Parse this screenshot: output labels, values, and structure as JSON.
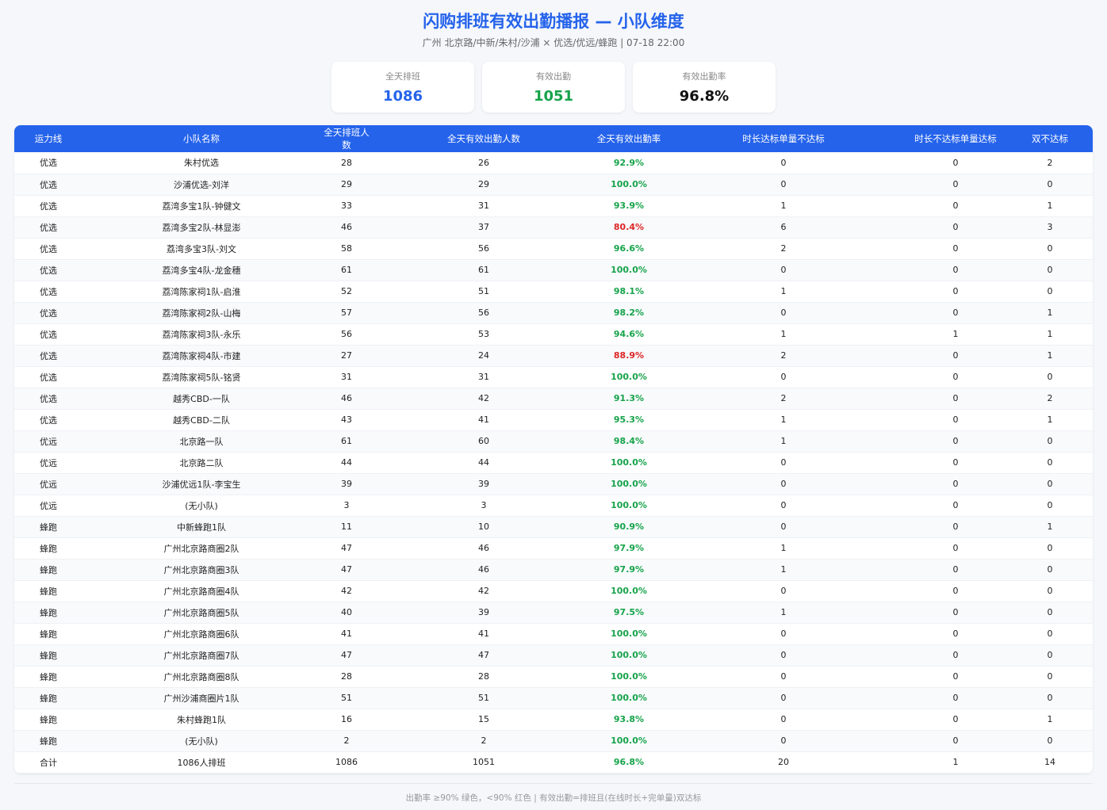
{
  "header": {
    "title": "闪购排班有效出勤播报 — 小队维度",
    "subtitle": "广州 北京路/中新/朱村/沙浦 × 优选/优远/蜂跑 | 07-18 22:00"
  },
  "cards": [
    {
      "label": "全天排班",
      "value": "1086"
    },
    {
      "label": "有效出勤",
      "value": "1051"
    },
    {
      "label": "有效出勤率",
      "value": "96.8%"
    }
  ],
  "table": {
    "columns": [
      "运力线",
      "小队名称",
      "全天排班人数",
      "全天有效出勤人数",
      "全天有效出勤率",
      "时长达标单量不达标",
      "时长不达标单量达标",
      "双不达标"
    ],
    "rows": [
      [
        "优选",
        "朱村优选",
        "28",
        "26",
        "92.9%",
        "0",
        "0",
        "2"
      ],
      [
        "优选",
        "沙浦优选-刘洋",
        "29",
        "29",
        "100.0%",
        "0",
        "0",
        "0"
      ],
      [
        "优选",
        "荔湾多宝1队-钟健文",
        "33",
        "31",
        "93.9%",
        "1",
        "0",
        "1"
      ],
      [
        "优选",
        "荔湾多宝2队-林显澎",
        "46",
        "37",
        "80.4%",
        "6",
        "0",
        "3"
      ],
      [
        "优选",
        "荔湾多宝3队-刘文",
        "58",
        "56",
        "96.6%",
        "2",
        "0",
        "0"
      ],
      [
        "优选",
        "荔湾多宝4队-龙金穗",
        "61",
        "61",
        "100.0%",
        "0",
        "0",
        "0"
      ],
      [
        "优选",
        "荔湾陈家祠1队-启淮",
        "52",
        "51",
        "98.1%",
        "1",
        "0",
        "0"
      ],
      [
        "优选",
        "荔湾陈家祠2队-山梅",
        "57",
        "56",
        "98.2%",
        "0",
        "0",
        "1"
      ],
      [
        "优选",
        "荔湾陈家祠3队-永乐",
        "56",
        "53",
        "94.6%",
        "1",
        "1",
        "1"
      ],
      [
        "优选",
        "荔湾陈家祠4队-市建",
        "27",
        "24",
        "88.9%",
        "2",
        "0",
        "1"
      ],
      [
        "优选",
        "荔湾陈家祠5队-铭贤",
        "31",
        "31",
        "100.0%",
        "0",
        "0",
        "0"
      ],
      [
        "优选",
        "越秀CBD-一队",
        "46",
        "42",
        "91.3%",
        "2",
        "0",
        "2"
      ],
      [
        "优选",
        "越秀CBD-二队",
        "43",
        "41",
        "95.3%",
        "1",
        "0",
        "1"
      ],
      [
        "优远",
        "北京路一队",
        "61",
        "60",
        "98.4%",
        "1",
        "0",
        "0"
      ],
      [
        "优远",
        "北京路二队",
        "44",
        "44",
        "100.0%",
        "0",
        "0",
        "0"
      ],
      [
        "优远",
        "沙浦优远1队-李宝生",
        "39",
        "39",
        "100.0%",
        "0",
        "0",
        "0"
      ],
      [
        "优远",
        "(无小队)",
        "3",
        "3",
        "100.0%",
        "0",
        "0",
        "0"
      ],
      [
        "蜂跑",
        "中新蜂跑1队",
        "11",
        "10",
        "90.9%",
        "0",
        "0",
        "1"
      ],
      [
        "蜂跑",
        "广州北京路商圈2队",
        "47",
        "46",
        "97.9%",
        "1",
        "0",
        "0"
      ],
      [
        "蜂跑",
        "广州北京路商圈3队",
        "47",
        "46",
        "97.9%",
        "1",
        "0",
        "0"
      ],
      [
        "蜂跑",
        "广州北京路商圈4队",
        "42",
        "42",
        "100.0%",
        "0",
        "0",
        "0"
      ],
      [
        "蜂跑",
        "广州北京路商圈5队",
        "40",
        "39",
        "97.5%",
        "1",
        "0",
        "0"
      ],
      [
        "蜂跑",
        "广州北京路商圈6队",
        "41",
        "41",
        "100.0%",
        "0",
        "0",
        "0"
      ],
      [
        "蜂跑",
        "广州北京路商圈7队",
        "47",
        "47",
        "100.0%",
        "0",
        "0",
        "0"
      ],
      [
        "蜂跑",
        "广州北京路商圈8队",
        "28",
        "28",
        "100.0%",
        "0",
        "0",
        "0"
      ],
      [
        "蜂跑",
        "广州沙浦商圈片1队",
        "51",
        "51",
        "100.0%",
        "0",
        "0",
        "0"
      ],
      [
        "蜂跑",
        "朱村蜂跑1队",
        "16",
        "15",
        "93.8%",
        "0",
        "0",
        "1"
      ],
      [
        "蜂跑",
        "(无小队)",
        "2",
        "2",
        "100.0%",
        "0",
        "0",
        "0"
      ]
    ],
    "total": [
      "合计",
      "1086人排班",
      "1086",
      "1051",
      "96.8%",
      "20",
      "1",
      "14"
    ]
  },
  "footer": "出勤率 ≥90% 绿色，<90% 红色 | 有效出勤=排班且(在线时长+完单量)双达标",
  "colors": {
    "accent": "#2563eb",
    "ok": "#16a34a",
    "bad": "#dc2626"
  }
}
